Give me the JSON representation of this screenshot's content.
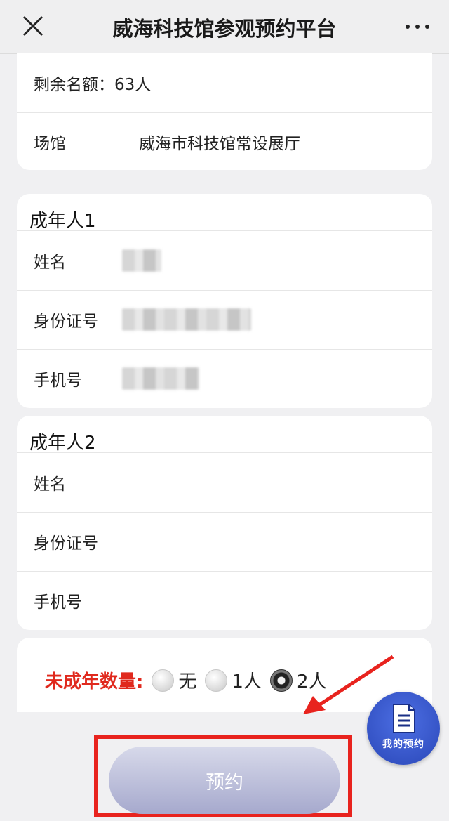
{
  "header": {
    "title": "威海科技馆参观预约平台"
  },
  "info": {
    "remaining": "剩余名额：63人",
    "venue_label": "场馆",
    "venue_value": "威海市科技馆常设展厅"
  },
  "adult1": {
    "title": "成年人1",
    "name_label": "姓名",
    "id_label": "身份证号",
    "phone_label": "手机号"
  },
  "adult2": {
    "title": "成年人2",
    "name_label": "姓名",
    "id_label": "身份证号",
    "phone_label": "手机号"
  },
  "minors": {
    "label": "未成年数量:",
    "options": [
      "无",
      "1人",
      "2人"
    ],
    "selected": "2人"
  },
  "fab": {
    "label": "我的预约",
    "icon": "document-icon"
  },
  "reserve_button": {
    "label": "预约"
  },
  "annotation": {
    "arrow_color": "#e8231e",
    "box_color": "#e8231e"
  }
}
